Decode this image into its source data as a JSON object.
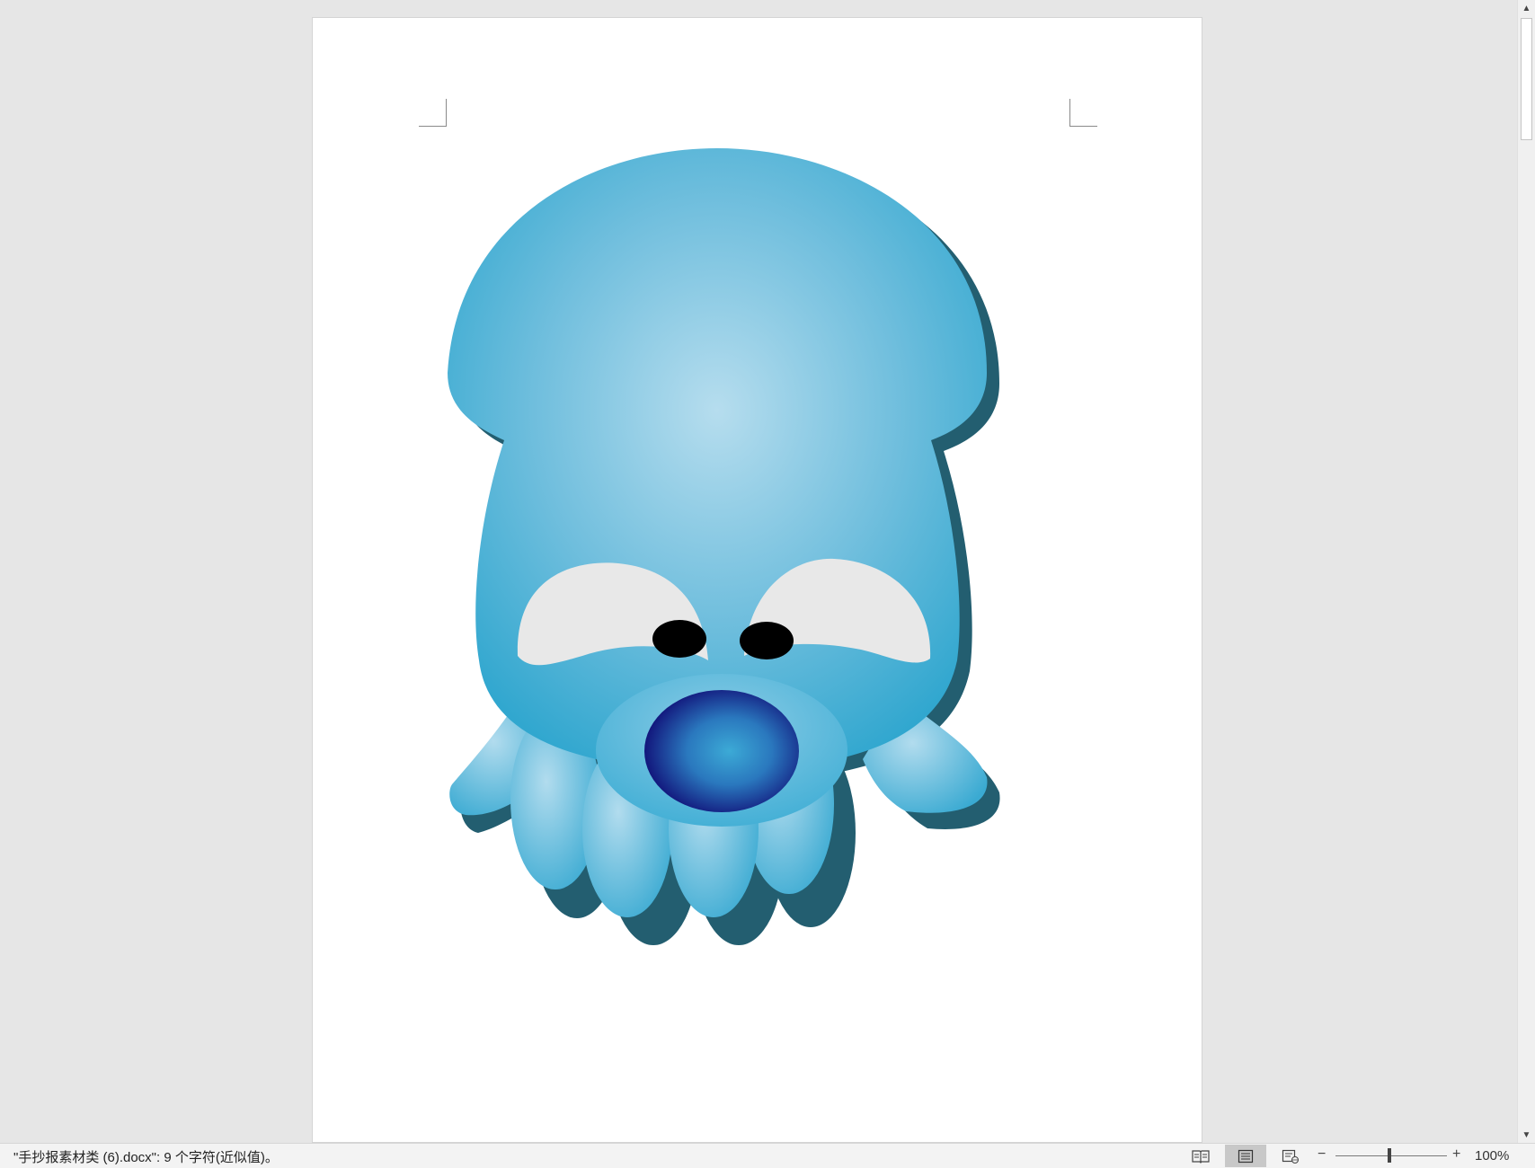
{
  "statusbar": {
    "document_status": "\"手抄报素材类 (6).docx\": 9 个字符(近似值)。",
    "views": [
      {
        "name": "read-mode-icon",
        "active": false
      },
      {
        "name": "print-layout-icon",
        "active": true
      },
      {
        "name": "web-layout-icon",
        "active": false
      }
    ],
    "zoom_minus": "−",
    "zoom_plus": "+",
    "zoom_level": "100%",
    "zoom_percent": 100
  },
  "document": {
    "image": "squid-clipart-illustration"
  },
  "colors": {
    "workspace": "#e6e6e6",
    "page": "#ffffff",
    "squid_light": "#b4dcee",
    "squid_base": "#36a9d0",
    "squid_shadow": "#235e70",
    "nose_center": "#3aa8d8",
    "nose_edge": "#13177e"
  }
}
